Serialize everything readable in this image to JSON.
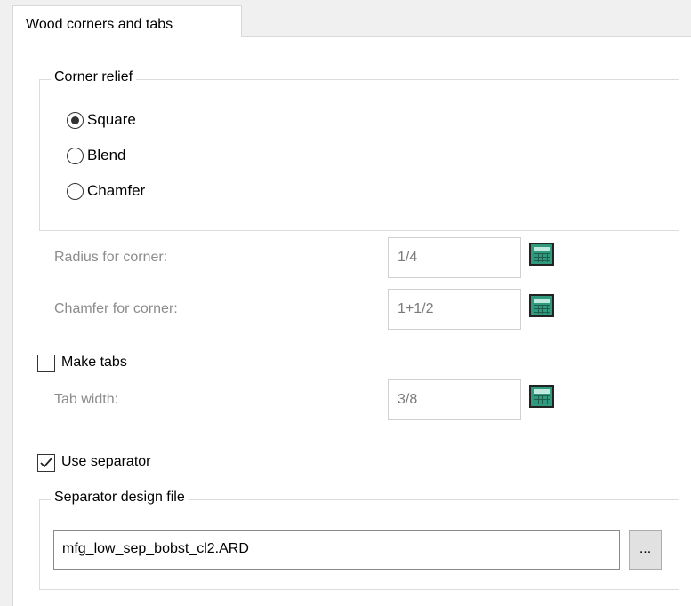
{
  "tab": {
    "label": "Wood corners and tabs"
  },
  "corner_relief": {
    "title": "Corner relief",
    "options": [
      {
        "label": "Square",
        "selected": true
      },
      {
        "label": "Blend",
        "selected": false
      },
      {
        "label": "Chamfer",
        "selected": false
      }
    ]
  },
  "radius": {
    "label": "Radius for corner:",
    "value": "1/4"
  },
  "chamfer": {
    "label": "Chamfer for corner:",
    "value": "1+1/2"
  },
  "make_tabs": {
    "label": "Make tabs",
    "checked": false
  },
  "tab_width": {
    "label": "Tab width:",
    "value": "3/8"
  },
  "use_separator": {
    "label": "Use separator",
    "checked": true
  },
  "separator": {
    "title": "Separator design file",
    "file": "mfg_low_sep_bobst_cl2.ARD",
    "browse_label": "..."
  },
  "icons": {
    "calculator": "calculator-icon",
    "checkmark": "checkmark-icon"
  },
  "colors": {
    "calculator": "#2f9a7d",
    "disabled_text": "#8c8c8c"
  }
}
